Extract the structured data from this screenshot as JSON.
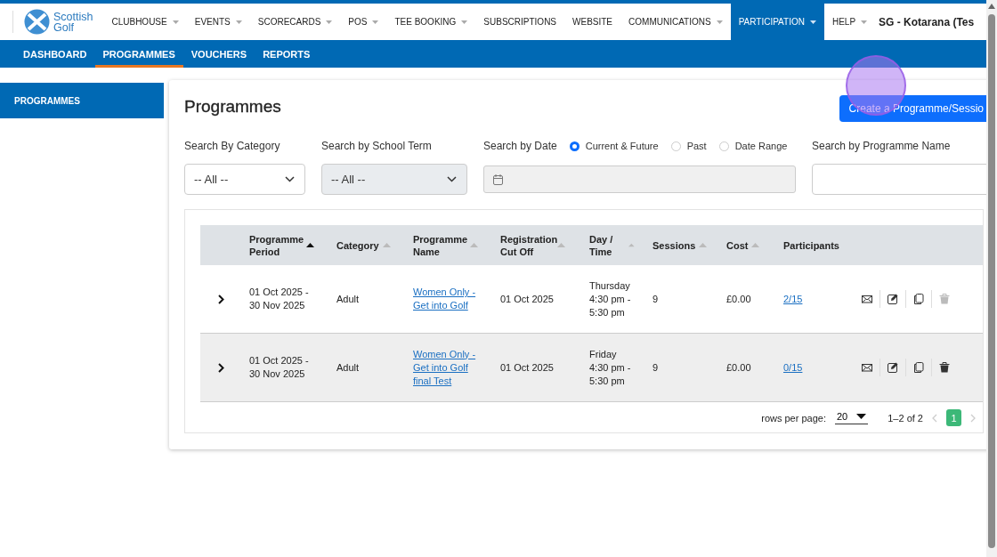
{
  "nav": {
    "logo": {
      "line1": "Scottish",
      "line2": "Golf"
    },
    "menu": [
      {
        "label": "CLUBHOUSE",
        "dropdown": true,
        "selected": false
      },
      {
        "label": "EVENTS",
        "dropdown": true,
        "selected": false
      },
      {
        "label": "SCORECARDS",
        "dropdown": true,
        "selected": false
      },
      {
        "label": "POS",
        "dropdown": true,
        "selected": false
      },
      {
        "label": "TEE BOOKING",
        "dropdown": true,
        "selected": false
      },
      {
        "label": "SUBSCRIPTIONS",
        "dropdown": false,
        "selected": false
      },
      {
        "label": "WEBSITE",
        "dropdown": false,
        "selected": false
      },
      {
        "label": "COMMUNICATIONS",
        "dropdown": true,
        "selected": false
      },
      {
        "label": "PARTICIPATION",
        "dropdown": true,
        "selected": true
      },
      {
        "label": "HELP",
        "dropdown": true,
        "selected": false
      }
    ],
    "account": "SG - Kotarana (Tes"
  },
  "subnav": [
    {
      "label": "DASHBOARD",
      "selected": false
    },
    {
      "label": "PROGRAMMES",
      "selected": true
    },
    {
      "label": "VOUCHERS",
      "selected": false
    },
    {
      "label": "REPORTS",
      "selected": false
    }
  ],
  "sidebar": {
    "items": [
      {
        "label": "PROGRAMMES",
        "selected": true
      }
    ]
  },
  "page": {
    "title": "Programmes",
    "create_button": "Create a Programme/Sessio"
  },
  "filters": {
    "category": {
      "label": "Search By Category",
      "value": "-- All --",
      "disabled": false
    },
    "school_term": {
      "label": "Search by School Term",
      "value": "-- All --",
      "disabled": true
    },
    "date": {
      "label": "Search by Date",
      "disabled": true,
      "options": [
        {
          "label": "Current & Future",
          "selected": true
        },
        {
          "label": "Past",
          "selected": false
        },
        {
          "label": "Date Range",
          "selected": false
        }
      ]
    },
    "name": {
      "label": "Search by Programme Name"
    }
  },
  "table": {
    "columns": [
      {
        "label": "Programme Period",
        "sortable": true,
        "sorted": true
      },
      {
        "label": "Category",
        "sortable": true,
        "sorted": false
      },
      {
        "label": "Programme Name",
        "sortable": true,
        "sorted": false
      },
      {
        "label": "Registration Cut Off",
        "sortable": true,
        "sorted": false
      },
      {
        "label": "Day / Time",
        "sortable": true,
        "sorted": false
      },
      {
        "label": "Sessions",
        "sortable": true,
        "sorted": false
      },
      {
        "label": "Cost",
        "sortable": true,
        "sorted": false
      },
      {
        "label": "Participants",
        "sortable": false
      }
    ],
    "rows": [
      {
        "period": "01 Oct 2025 - 30 Nov 2025",
        "category": "Adult",
        "name": "Women Only - Get into Golf",
        "cut_off": "01 Oct 2025",
        "day_time": "Thursday 4:30 pm - 5:30 pm",
        "sessions": "9",
        "cost": "£0.00",
        "participants": "2/15",
        "highlighted": false,
        "delete_disabled": true
      },
      {
        "period": "01 Oct 2025 - 30 Nov 2025",
        "category": "Adult",
        "name": "Women Only - Get into Golf final Test",
        "cut_off": "01 Oct 2025",
        "day_time": "Friday 4:30 pm - 5:30 pm",
        "sessions": "9",
        "cost": "£0.00",
        "participants": "0/15",
        "highlighted": true,
        "delete_disabled": false
      }
    ],
    "footer": {
      "rows_per_page_label": "rows per page:",
      "rows_per_page": "20",
      "range": "1–2 of 2",
      "pages": [
        {
          "label": "1",
          "selected": true
        }
      ],
      "prev_disabled": true,
      "next_disabled": true
    }
  }
}
